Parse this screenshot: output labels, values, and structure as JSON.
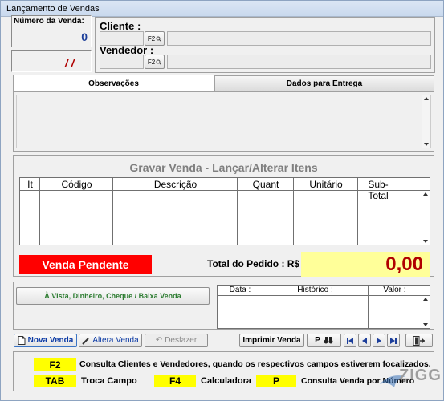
{
  "window": {
    "title": "Lançamento de Vendas"
  },
  "header": {
    "numero_venda_label": "Número da Venda:",
    "numero_venda_value": "0",
    "date_value": "/ /",
    "cliente_label": "Cliente :",
    "vendedor_label": "Vendedor :",
    "f2_label": "F2"
  },
  "tabs": [
    {
      "label": "Observações",
      "active": true
    },
    {
      "label": "Dados para Entrega",
      "active": false
    }
  ],
  "items_grid": {
    "title": "Gravar Venda - Lançar/Alterar Itens",
    "columns": [
      "It",
      "Código",
      "Descrição",
      "Quant",
      "Unitário",
      "Sub-Total"
    ]
  },
  "status": {
    "text": "Venda Pendente",
    "color": "#ff0000"
  },
  "total": {
    "label": "Total do Pedido : R$",
    "value": "0,00",
    "bg_color": "#ffff99",
    "text_color": "#b00000"
  },
  "payment_button": {
    "label": "À Vista, Dinheiro, Cheque / Baixa Venda"
  },
  "payments_grid": {
    "columns": [
      "Data :",
      "Histórico :",
      "Valor :"
    ]
  },
  "toolbar": {
    "nova_venda": "Nova Venda",
    "altera_venda": "Altera Venda",
    "desfazer": "Desfazer",
    "imprimir_venda": "Imprimir Venda",
    "p_search": "P"
  },
  "shortcuts": {
    "f2_key": "F2",
    "f2_desc": "Consulta Clientes e Vendedores, quando os respectivos campos estiverem focalizados.",
    "tab_key": "TAB",
    "tab_desc": "Troca Campo",
    "f4_key": "F4",
    "f4_desc": "Calculadora",
    "p_key": "P",
    "p_desc": "Consulta Venda por Número",
    "key_color": "#ffff00"
  },
  "watermark": {
    "text": "ZIGG"
  }
}
